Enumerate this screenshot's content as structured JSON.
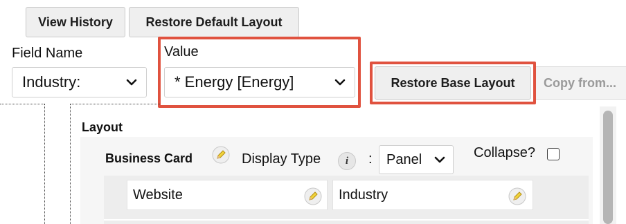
{
  "toolbar": {
    "view_history_label": "View History",
    "restore_default_label": "Restore Default Layout",
    "restore_base_label": "Restore Base Layout",
    "copy_from_label": "Copy from..."
  },
  "filters": {
    "field_name_label": "Field Name",
    "field_name_value": "Industry:",
    "value_label": "Value",
    "value_selected": "* Energy [Energy]"
  },
  "layout": {
    "heading": "Layout",
    "panel": {
      "title": "Business Card",
      "display_type_label": "Display Type",
      "info_icon_text": "i",
      "colon": ":",
      "display_type_value": "Panel",
      "collapse_label": "Collapse?",
      "collapse_checked": false,
      "fields": [
        "Website",
        "Industry"
      ]
    }
  },
  "colors": {
    "highlight": "#e0523f",
    "button_bg": "#efefef"
  },
  "icons": [
    "chevron-down-icon",
    "pencil-icon",
    "info-icon"
  ]
}
